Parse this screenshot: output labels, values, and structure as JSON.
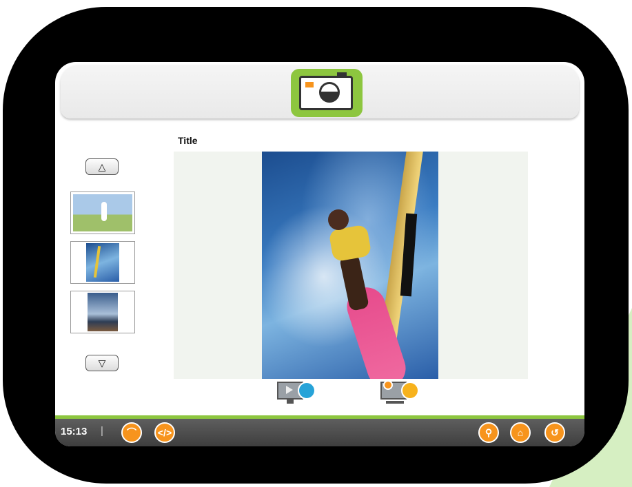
{
  "header": {
    "camera_icon": "camera-icon"
  },
  "viewer": {
    "title": "Title"
  },
  "thumbs": {
    "up_label": "△",
    "down_label": "▽",
    "items": [
      "thumbnail-person-meadow",
      "thumbnail-windsurfer",
      "thumbnail-sea-sky"
    ]
  },
  "actions": {
    "play_icon": "monitor-play-icon",
    "share_icon": "monitor-share-icon"
  },
  "statusbar": {
    "time": "15:13",
    "separator": "|",
    "wifi_glyph": "⌒",
    "code_glyph": "</>",
    "key_glyph": "⚲",
    "home_glyph": "⌂",
    "back_glyph": "↺"
  },
  "colors": {
    "accent_green": "#8dc63f",
    "accent_orange": "#f7941d",
    "bezel": "#000000"
  }
}
